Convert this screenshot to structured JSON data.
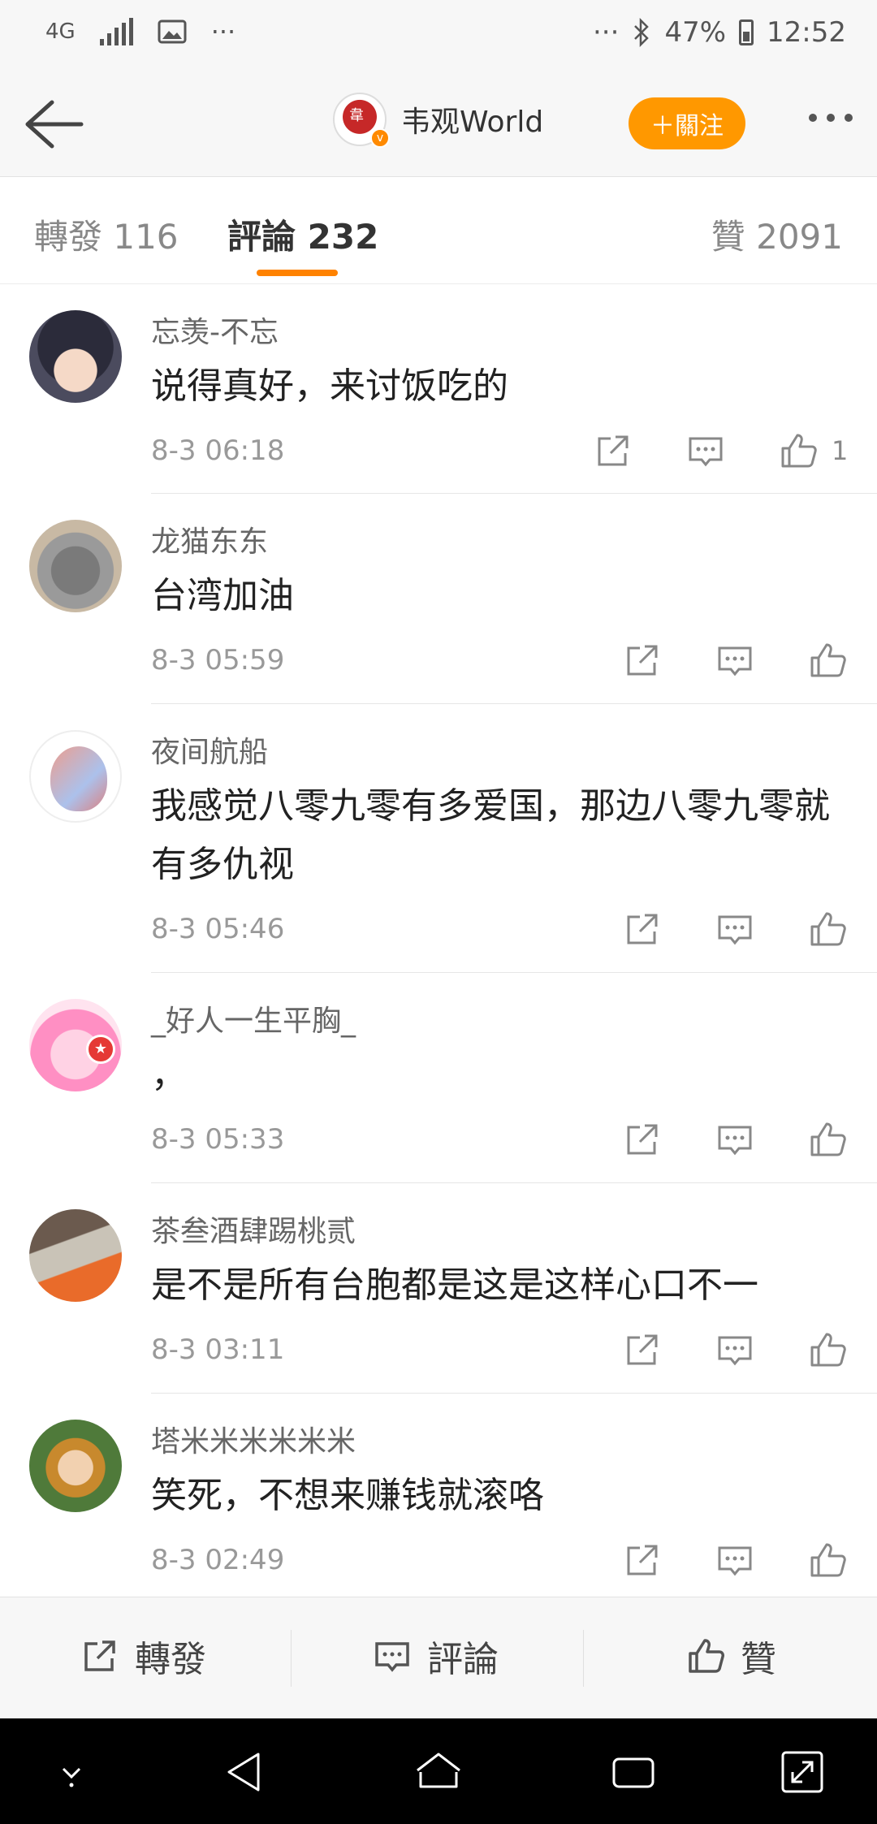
{
  "status_bar": {
    "network": "4G",
    "battery": "47%",
    "time": "12:52",
    "icons": [
      "4g-icon",
      "signal-icon",
      "image-icon",
      "more-dots-icon",
      "bluetooth-icon",
      "battery-icon"
    ]
  },
  "header": {
    "account_name": "韦观World",
    "follow_label": "＋關注"
  },
  "tabs": [
    {
      "label": "轉發 116"
    },
    {
      "label": "評論 232"
    },
    {
      "label": "贊 2091"
    }
  ],
  "comments": [
    {
      "name": "忘羡-不忘",
      "text": "说得真好，来讨饭吃的",
      "time": "8-3 06:18",
      "likes": "1"
    },
    {
      "name": "龙猫东东",
      "text": "台湾加油",
      "time": "8-3 05:59",
      "likes": ""
    },
    {
      "name": "夜间航船",
      "text": "我感觉八零九零有多爱国，那边八零九零就有多仇视",
      "time": "8-3 05:46",
      "likes": ""
    },
    {
      "name": "_好人一生平胸_",
      "text": "，",
      "time": "8-3 05:33",
      "likes": ""
    },
    {
      "name": "茶叁酒肆踢桃贰",
      "text": "是不是所有台胞都是这是这样心口不一",
      "time": "8-3 03:11",
      "likes": ""
    },
    {
      "name": "塔米米米米米米",
      "text": "笑死，不想来赚钱就滚咯",
      "time": "8-3 02:49",
      "likes": ""
    }
  ],
  "action_bar": {
    "repost": "轉發",
    "comment": "評論",
    "like": "贊"
  },
  "colors": {
    "accent": "#ff8200",
    "follow_button": "#ff9800",
    "text_primary": "#222222",
    "text_secondary": "#999999"
  }
}
